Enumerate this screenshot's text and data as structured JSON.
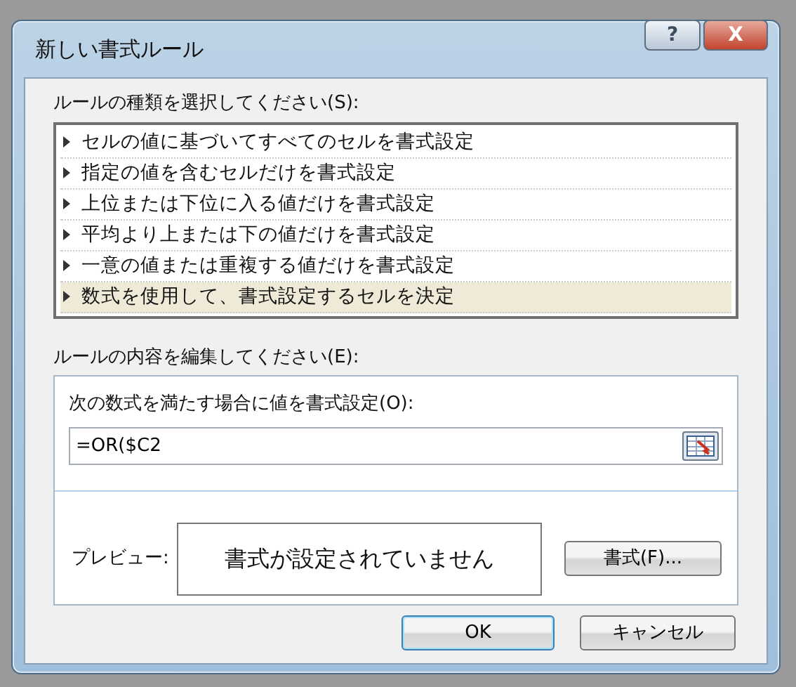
{
  "window": {
    "title": "新しい書式ルール",
    "help_button": "?",
    "close_button": "X"
  },
  "rule_type": {
    "label": "ルールの種類を選択してください(S):",
    "items": [
      {
        "label": "セルの値に基づいてすべてのセルを書式設定",
        "selected": false
      },
      {
        "label": "指定の値を含むセルだけを書式設定",
        "selected": false
      },
      {
        "label": "上位または下位に入る値だけを書式設定",
        "selected": false
      },
      {
        "label": "平均より上または下の値だけを書式設定",
        "selected": false
      },
      {
        "label": "一意の値または重複する値だけを書式設定",
        "selected": false
      },
      {
        "label": "数式を使用して、書式設定するセルを決定",
        "selected": true
      }
    ]
  },
  "rule_edit": {
    "label": "ルールの内容を編集してください(E):",
    "formula_label": "次の数式を満たす場合に値を書式設定(O):",
    "formula": "=OR($C2",
    "preview_label": "プレビュー:",
    "preview_text": "書式が設定されていません",
    "format_button": "書式(F)..."
  },
  "buttons": [
    "OK",
    "キャンセル"
  ]
}
